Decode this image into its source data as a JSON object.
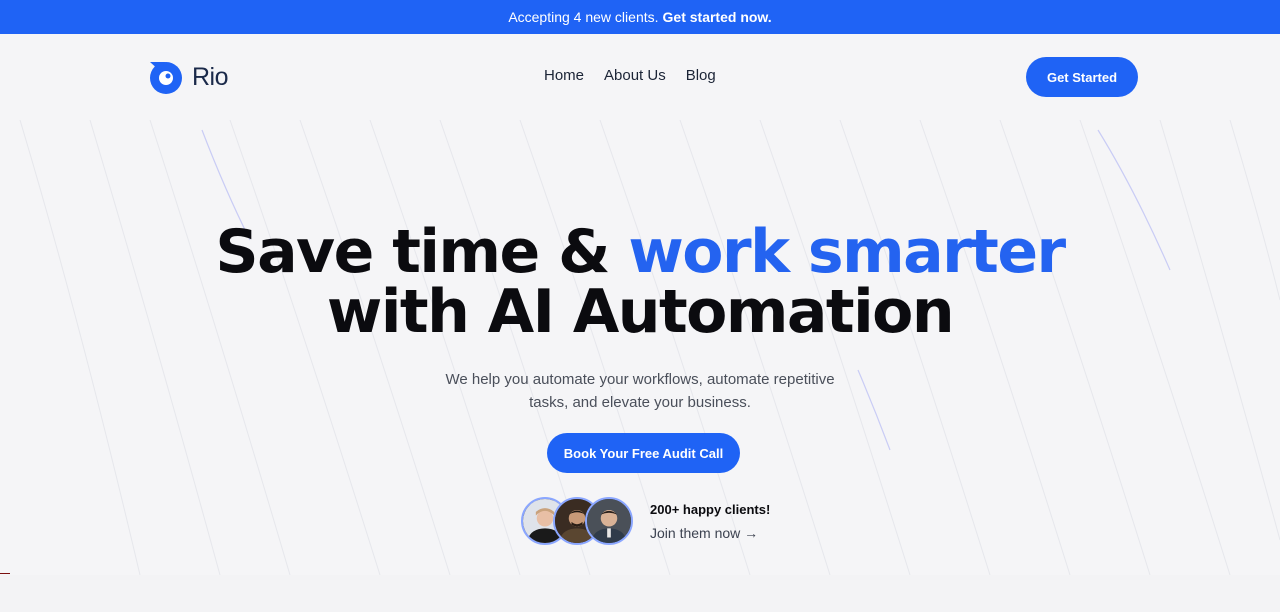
{
  "announcement": {
    "text": "Accepting 4 new clients.",
    "cta": "Get started now."
  },
  "brand": {
    "name": "Rio",
    "accent_color": "#1f63f5"
  },
  "nav": {
    "links": [
      "Home",
      "About Us",
      "Blog"
    ],
    "cta": "Get Started"
  },
  "hero": {
    "title_part1": "Save time & ",
    "title_accent": "work smarter",
    "title_line2": "with AI Automation",
    "subtitle_line1": "We help you automate your workflows, automate repetitive",
    "subtitle_line2": "tasks, and elevate your business.",
    "cta": "Book Your Free Audit Call"
  },
  "social_proof": {
    "title": "200+ happy clients!",
    "link": "Join them now →",
    "avatar_count": 3
  }
}
